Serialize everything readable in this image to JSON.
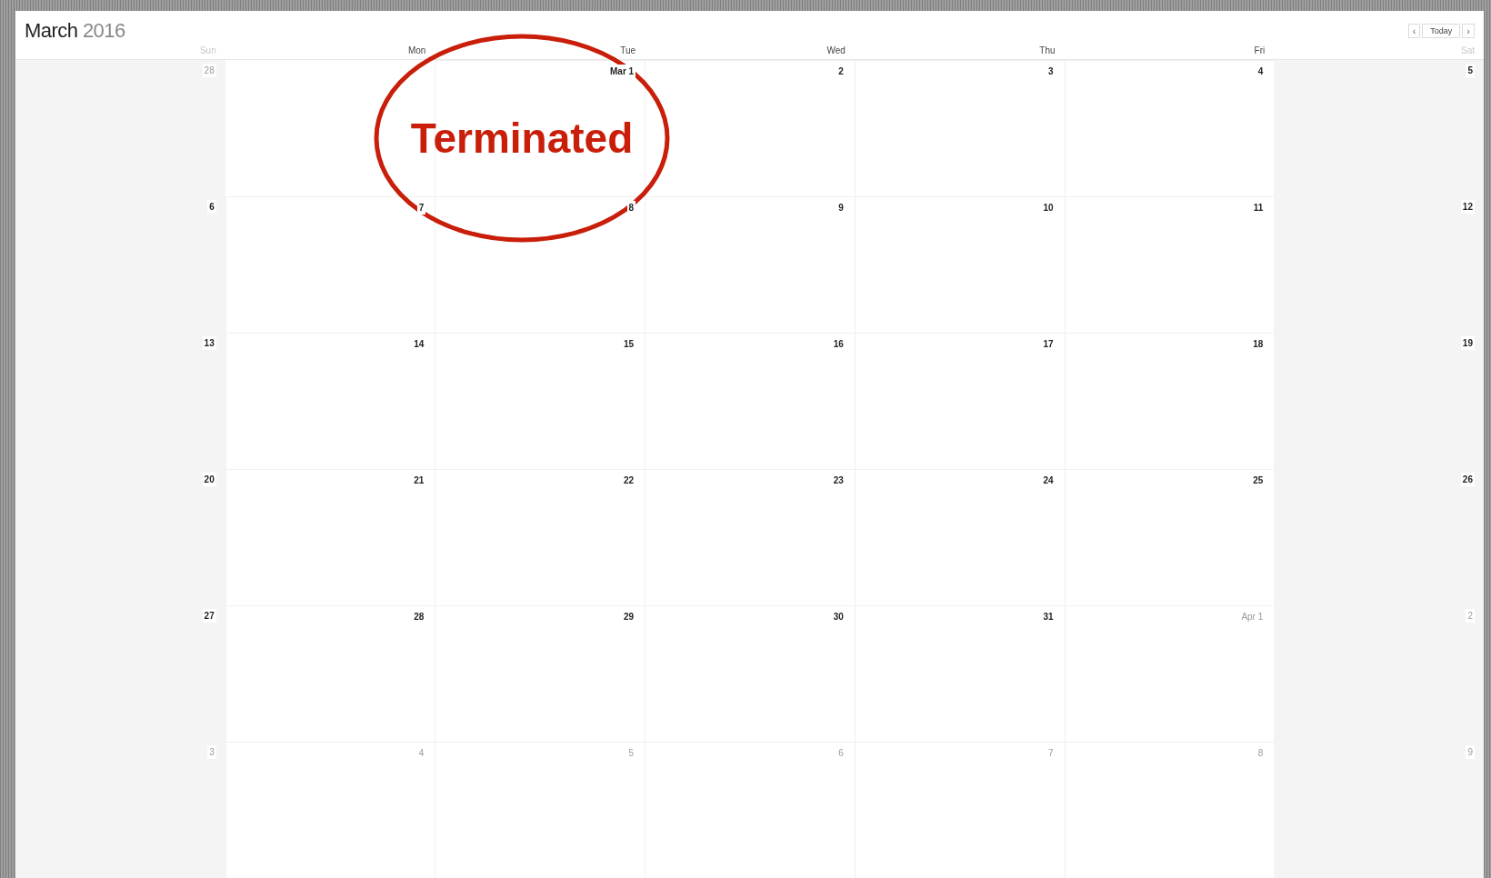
{
  "title": {
    "month": "March",
    "year": "2016"
  },
  "nav": {
    "prev": "‹",
    "today": "Today",
    "next": "›"
  },
  "columns": [
    {
      "label": "Sun",
      "weekend": true
    },
    {
      "label": "Mon",
      "weekend": false
    },
    {
      "label": "Tue",
      "weekend": false
    },
    {
      "label": "Wed",
      "weekend": false
    },
    {
      "label": "Thu",
      "weekend": false
    },
    {
      "label": "Fri",
      "weekend": false
    },
    {
      "label": "Sat",
      "weekend": true
    }
  ],
  "weeks": [
    {
      "monday_covered": true,
      "days": [
        {
          "label": "28",
          "muted": true
        },
        {
          "label": "Mar 1",
          "muted": false
        },
        {
          "label": "2",
          "muted": false
        },
        {
          "label": "3",
          "muted": false
        },
        {
          "label": "4",
          "muted": false
        },
        {
          "label": "5",
          "muted": false
        }
      ]
    },
    [
      {
        "label": "6",
        "muted": false
      },
      {
        "label": "7",
        "muted": false
      },
      {
        "label": "8",
        "muted": false
      },
      {
        "label": "9",
        "muted": false
      },
      {
        "label": "10",
        "muted": false
      },
      {
        "label": "11",
        "muted": false
      },
      {
        "label": "12",
        "muted": false
      }
    ],
    [
      {
        "label": "13",
        "muted": false
      },
      {
        "label": "14",
        "muted": false
      },
      {
        "label": "15",
        "muted": false
      },
      {
        "label": "16",
        "muted": false
      },
      {
        "label": "17",
        "muted": false
      },
      {
        "label": "18",
        "muted": false
      },
      {
        "label": "19",
        "muted": false
      }
    ],
    [
      {
        "label": "20",
        "muted": false
      },
      {
        "label": "21",
        "muted": false
      },
      {
        "label": "22",
        "muted": false
      },
      {
        "label": "23",
        "muted": false
      },
      {
        "label": "24",
        "muted": false
      },
      {
        "label": "25",
        "muted": false
      },
      {
        "label": "26",
        "muted": false
      }
    ],
    [
      {
        "label": "27",
        "muted": false
      },
      {
        "label": "28",
        "muted": false
      },
      {
        "label": "29",
        "muted": false
      },
      {
        "label": "30",
        "muted": false
      },
      {
        "label": "31",
        "muted": false
      },
      {
        "label": "Apr 1",
        "muted": true
      },
      {
        "label": "2",
        "muted": true
      }
    ],
    [
      {
        "label": "3",
        "muted": true
      },
      {
        "label": "4",
        "muted": true
      },
      {
        "label": "5",
        "muted": true
      },
      {
        "label": "6",
        "muted": true
      },
      {
        "label": "7",
        "muted": true
      },
      {
        "label": "8",
        "muted": true
      },
      {
        "label": "9",
        "muted": true
      }
    ]
  ],
  "annotation": {
    "text": "Terminated"
  }
}
